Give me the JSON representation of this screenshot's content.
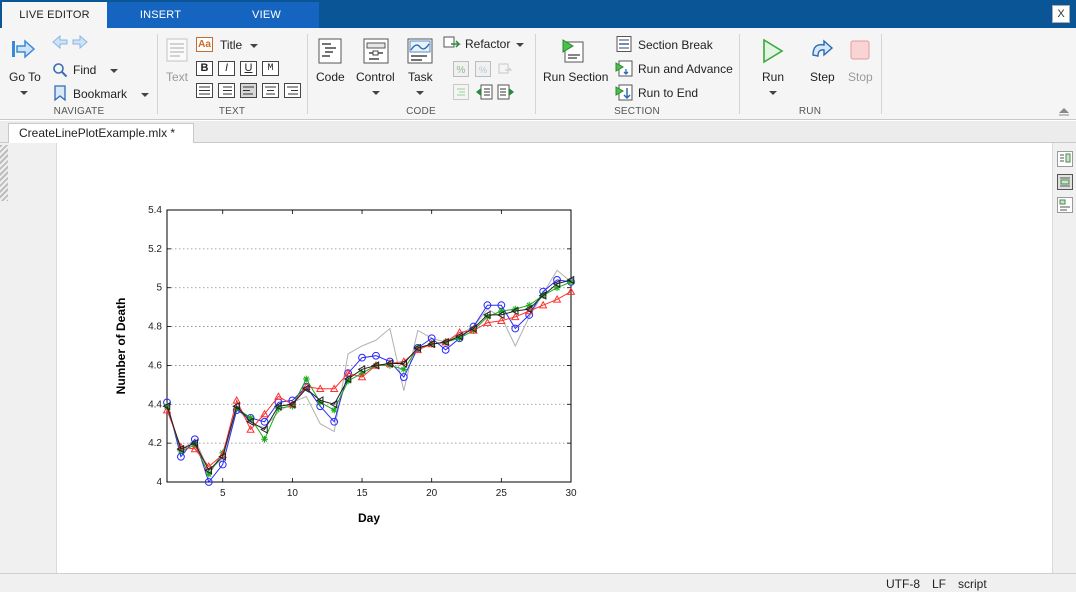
{
  "tabs": {
    "live_editor": "LIVE EDITOR",
    "insert": "INSERT",
    "view": "VIEW",
    "close": "X"
  },
  "ribbon": {
    "navigate": {
      "group": "NAVIGATE",
      "go_to": "Go To",
      "find": "Find",
      "bookmark": "Bookmark"
    },
    "text": {
      "group": "TEXT",
      "text_button": "Text",
      "title_style": "Title",
      "style_icon": "Aa",
      "bold": "B",
      "italic": "I",
      "underline": "U",
      "monospace": "M"
    },
    "code": {
      "group": "CODE",
      "code_button": "Code",
      "control_button": "Control",
      "task_button": "Task",
      "refactor_button": "Refactor"
    },
    "section": {
      "group": "SECTION",
      "run_section": "Run Section",
      "section_break": "Section Break",
      "run_and_advance": "Run and Advance",
      "run_to_end": "Run to End"
    },
    "run": {
      "group": "RUN",
      "run_button": "Run",
      "step_button": "Step",
      "stop_button": "Stop"
    }
  },
  "document": {
    "tab_label": "CreateLinePlotExample.mlx *"
  },
  "status": {
    "encoding": "UTF-8",
    "line_ending": "LF",
    "mode": "script"
  },
  "colors": {
    "tab_bar": "#0a5596",
    "series_gray": "#b0b0b0",
    "series_blue": "#2828ff",
    "series_green": "#18a818",
    "series_red": "#ff3030",
    "series_black": "#222222"
  },
  "chart_data": {
    "type": "line",
    "title": "",
    "xlabel": "Day",
    "ylabel": "Number of Death",
    "xlim": [
      1,
      30
    ],
    "ylim": [
      4,
      5.4
    ],
    "xticks": [
      5,
      10,
      15,
      20,
      25,
      30
    ],
    "yticks": [
      4,
      4.2,
      4.4,
      4.6,
      4.8,
      5,
      5.2,
      5.4
    ],
    "ytick_labels": [
      "4",
      "4.2",
      "4.4",
      "4.6",
      "4.8",
      "5",
      "5.2",
      "5.4"
    ],
    "grid": "horizontal dotted",
    "x": [
      1,
      2,
      3,
      4,
      5,
      6,
      7,
      8,
      9,
      10,
      11,
      12,
      13,
      14,
      15,
      16,
      17,
      18,
      19,
      20,
      21,
      22,
      23,
      24,
      25,
      26,
      27,
      28,
      29,
      30
    ],
    "series": [
      {
        "color": "#b0b0b0",
        "marker": "none",
        "values": [
          4.4,
          4.16,
          4.22,
          4.06,
          4.12,
          4.38,
          4.3,
          4.28,
          4.36,
          4.41,
          4.44,
          4.3,
          4.26,
          4.66,
          4.7,
          4.73,
          4.79,
          4.47,
          4.78,
          4.74,
          4.72,
          4.76,
          4.8,
          4.89,
          4.85,
          4.7,
          4.85,
          4.97,
          5.09,
          5.03
        ]
      },
      {
        "color": "#2828ff",
        "marker": "circle",
        "values": [
          4.41,
          4.13,
          4.22,
          4.0,
          4.09,
          4.37,
          4.33,
          4.31,
          4.41,
          4.42,
          4.49,
          4.39,
          4.31,
          4.56,
          4.64,
          4.65,
          4.62,
          4.54,
          4.69,
          4.74,
          4.68,
          4.74,
          4.8,
          4.91,
          4.91,
          4.79,
          4.86,
          4.98,
          5.04,
          5.03
        ]
      },
      {
        "color": "#18a818",
        "marker": "star",
        "values": [
          4.39,
          4.16,
          4.19,
          4.04,
          4.15,
          4.38,
          4.33,
          4.22,
          4.38,
          4.39,
          4.53,
          4.41,
          4.37,
          4.52,
          4.56,
          4.6,
          4.6,
          4.58,
          4.69,
          4.71,
          4.72,
          4.74,
          4.78,
          4.85,
          4.88,
          4.89,
          4.91,
          4.96,
          5.0,
          5.03
        ]
      },
      {
        "color": "#ff3030",
        "marker": "triangle-up",
        "values": [
          4.37,
          4.18,
          4.17,
          4.08,
          4.14,
          4.42,
          4.27,
          4.35,
          4.44,
          4.4,
          4.49,
          4.48,
          4.48,
          4.56,
          4.54,
          4.6,
          4.61,
          4.62,
          4.68,
          4.71,
          4.72,
          4.77,
          4.78,
          4.82,
          4.83,
          4.85,
          4.88,
          4.91,
          4.94,
          4.98
        ]
      },
      {
        "color": "#222222",
        "marker": "triangle-left",
        "values": [
          4.39,
          4.17,
          4.2,
          4.06,
          4.13,
          4.39,
          4.31,
          4.27,
          4.39,
          4.4,
          4.48,
          4.42,
          4.4,
          4.53,
          4.58,
          4.6,
          4.61,
          4.61,
          4.69,
          4.71,
          4.72,
          4.75,
          4.79,
          4.86,
          4.86,
          4.88,
          4.89,
          4.96,
          5.02,
          5.04
        ]
      }
    ]
  }
}
